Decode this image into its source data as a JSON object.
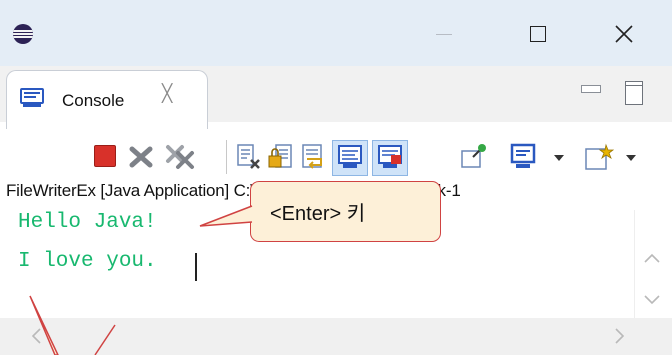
{
  "window": {
    "app_icon": "eclipse-icon",
    "min_icon": "minimize-icon",
    "max_icon": "maximize-icon",
    "close_icon": "close-icon"
  },
  "view": {
    "tab_label": "Console",
    "tab_close_glyph": "╳",
    "tab_icon": "console-monitor-icon"
  },
  "toolbar": {
    "items": [
      "terminate-icon",
      "remove-launch-icon",
      "remove-all-terminated-icon",
      "clear-console-icon",
      "scroll-lock-icon",
      "word-wrap-icon",
      "show-on-stdout-icon",
      "show-on-stderr-icon",
      "pin-console-icon",
      "display-console-icon",
      "open-console-icon"
    ]
  },
  "console": {
    "title": "FileWriterEx [Java Application] C:\\Program Files₩Java₩jdk-1",
    "lines": [
      "Hello Java!",
      "I love you."
    ],
    "output_color": "#18b86f"
  },
  "callout": {
    "text": "<Enter> 키",
    "fill": "#fdf0d8",
    "border": "#d04342"
  }
}
